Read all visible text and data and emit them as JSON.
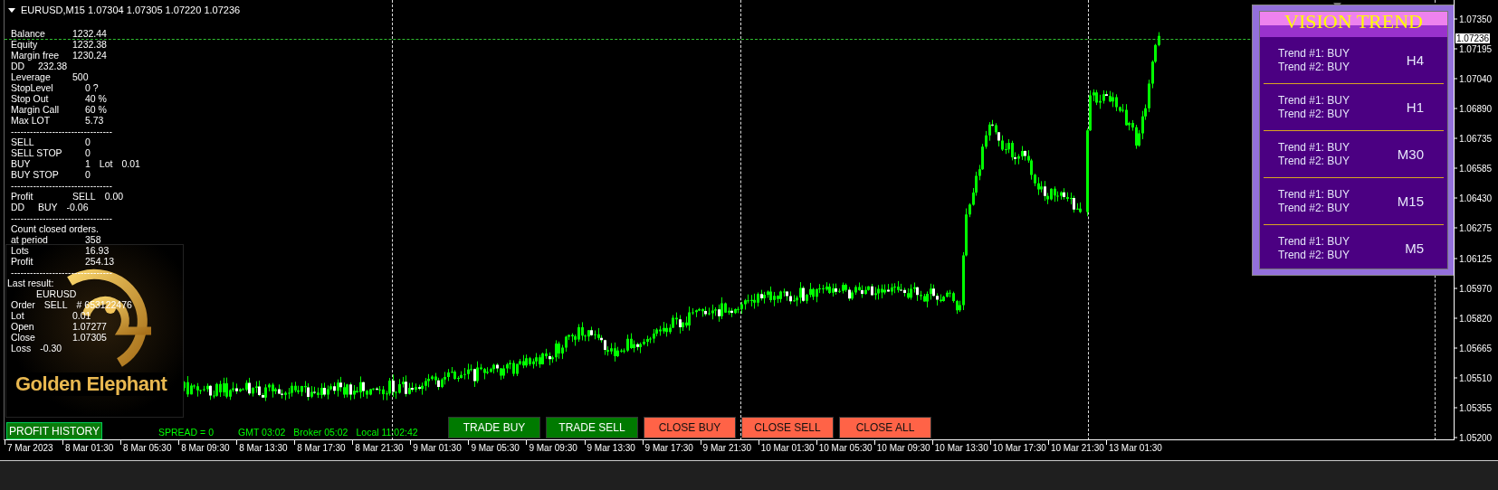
{
  "chart": {
    "title": "EURUSD,M15  1.07304 1.07305 1.07220 1.07236",
    "current_price": "1.07236",
    "price_axis": [
      "1.07350",
      "1.07195",
      "1.07040",
      "1.06890",
      "1.06735",
      "1.06585",
      "1.06430",
      "1.06275",
      "1.06125",
      "1.05970",
      "1.05820",
      "1.05665",
      "1.05510",
      "1.05355",
      "1.05200"
    ],
    "time_axis": [
      "7 Mar 2023",
      "8 Mar 01:30",
      "8 Mar 05:30",
      "8 Mar 09:30",
      "8 Mar 13:30",
      "8 Mar 17:30",
      "8 Mar 21:30",
      "9 Mar 01:30",
      "9 Mar 05:30",
      "9 Mar 09:30",
      "9 Mar 13:30",
      "9 Mar 17:30",
      "9 Mar 21:30",
      "10 Mar 01:30",
      "10 Mar 05:30",
      "10 Mar 09:30",
      "10 Mar 13:30",
      "10 Mar 17:30",
      "10 Mar 21:30",
      "13 Mar 01:30"
    ]
  },
  "account_panel": {
    "lines": [
      {
        "kind": "line",
        "parts": [
          "Balance",
          "1232.44"
        ]
      },
      {
        "kind": "line",
        "parts": [
          "Equity",
          "1232.38"
        ]
      },
      {
        "kind": "line",
        "parts": [
          "Margin free",
          "1230.24"
        ]
      },
      {
        "kind": "short",
        "parts": [
          "DD",
          "232.38"
        ]
      },
      {
        "kind": "line",
        "parts": [
          "Leverage",
          "500"
        ]
      },
      {
        "kind": "wide",
        "parts": [
          "StopLevel",
          "0 ?"
        ]
      },
      {
        "kind": "wide",
        "parts": [
          "Stop Out",
          "40 %"
        ]
      },
      {
        "kind": "wide",
        "parts": [
          "Margin Call",
          "60 %"
        ]
      },
      {
        "kind": "wide",
        "parts": [
          "Max LOT",
          "5.73"
        ]
      },
      {
        "kind": "rule",
        "parts": [
          "--------------------------------"
        ]
      },
      {
        "kind": "wide",
        "parts": [
          "SELL",
          "0"
        ]
      },
      {
        "kind": "wide",
        "parts": [
          "SELL STOP",
          "0"
        ]
      },
      {
        "kind": "wide",
        "parts": [
          "BUY",
          "1",
          "Lot",
          "0.01"
        ]
      },
      {
        "kind": "wide",
        "parts": [
          "BUY STOP",
          "0"
        ]
      },
      {
        "kind": "rule",
        "parts": [
          "--------------------------------"
        ]
      },
      {
        "kind": "line",
        "parts": [
          "Profit",
          "SELL",
          "0.00"
        ]
      },
      {
        "kind": "short",
        "parts": [
          "DD",
          "BUY",
          "-0.06"
        ]
      },
      {
        "kind": "rule",
        "parts": [
          "--------------------------------"
        ]
      },
      {
        "kind": "line",
        "parts": [
          "Count closed orders."
        ]
      },
      {
        "kind": "wide",
        "parts": [
          "at period",
          "358"
        ]
      },
      {
        "kind": "wide",
        "parts": [
          "Lots",
          "16.93"
        ]
      },
      {
        "kind": "wide",
        "parts": [
          "Profit",
          "254.13"
        ]
      },
      {
        "kind": "rule",
        "parts": [
          "--------------------------------"
        ]
      },
      {
        "kind": "heading",
        "parts": [
          "Last result:"
        ]
      },
      {
        "kind": "indent",
        "parts": [
          "EURUSD"
        ]
      },
      {
        "kind": "short",
        "parts": [
          "Order",
          "SELL",
          "# 653122476"
        ]
      },
      {
        "kind": "line",
        "parts": [
          "Lot",
          "0.01"
        ]
      },
      {
        "kind": "line",
        "parts": [
          "Open",
          "1.07277"
        ]
      },
      {
        "kind": "line",
        "parts": [
          "Close",
          "1.07305"
        ]
      },
      {
        "kind": "short",
        "parts": [
          "Loss",
          "-0.30"
        ]
      }
    ]
  },
  "logo": {
    "text": "Golden Elephant"
  },
  "profit_history_button": "PROFIT HISTORY",
  "status": [
    "SPREAD = 0",
    "GMT 03:02",
    "Broker 05:02",
    "Local 11:02:42"
  ],
  "buttons": [
    {
      "label": "TRADE BUY",
      "kind": "trade"
    },
    {
      "label": "TRADE SELL",
      "kind": "trade"
    },
    {
      "label": "CLOSE BUY",
      "kind": "close"
    },
    {
      "label": "CLOSE SELL",
      "kind": "close"
    },
    {
      "label": "CLOSE ALL",
      "kind": "close"
    }
  ],
  "vision_trend": {
    "title": "VISION TREND",
    "rows": [
      {
        "trend_1": "Trend #1: BUY",
        "trend_2": "Trend #2: BUY",
        "timeframe": "H4"
      },
      {
        "trend_1": "Trend #1: BUY",
        "trend_2": "Trend #2: BUY",
        "timeframe": "H1"
      },
      {
        "trend_1": "Trend #1: BUY",
        "trend_2": "Trend #2: BUY",
        "timeframe": "M30"
      },
      {
        "trend_1": "Trend #1: BUY",
        "trend_2": "Trend #2: BUY",
        "timeframe": "M15"
      },
      {
        "trend_1": "Trend #1: BUY",
        "trend_2": "Trend #2: BUY",
        "timeframe": "M5"
      }
    ]
  }
}
